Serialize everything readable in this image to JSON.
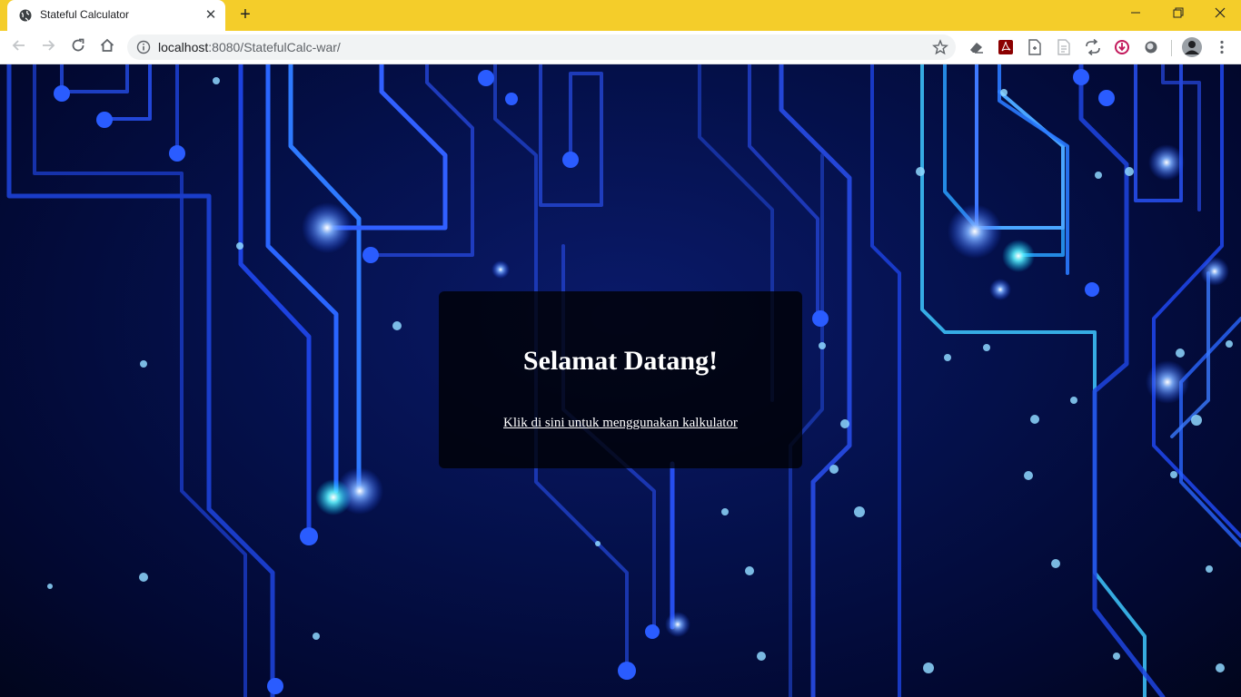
{
  "browser": {
    "tab_title": "Stateful Calculator",
    "url_host": "localhost",
    "url_rest": ":8080/StatefulCalc-war/",
    "theme_color": "#f4cd2a"
  },
  "page": {
    "heading": "Selamat Datang!",
    "link_text": "Klik di sini untuk menggunakan kalkulator"
  },
  "icons": {
    "extensions": [
      "eraser-extension-icon",
      "pdf-extension-icon",
      "page-extension-icon",
      "document-extension-icon",
      "translate-extension-icon",
      "download-extension-icon",
      "circle-extension-icon"
    ]
  }
}
